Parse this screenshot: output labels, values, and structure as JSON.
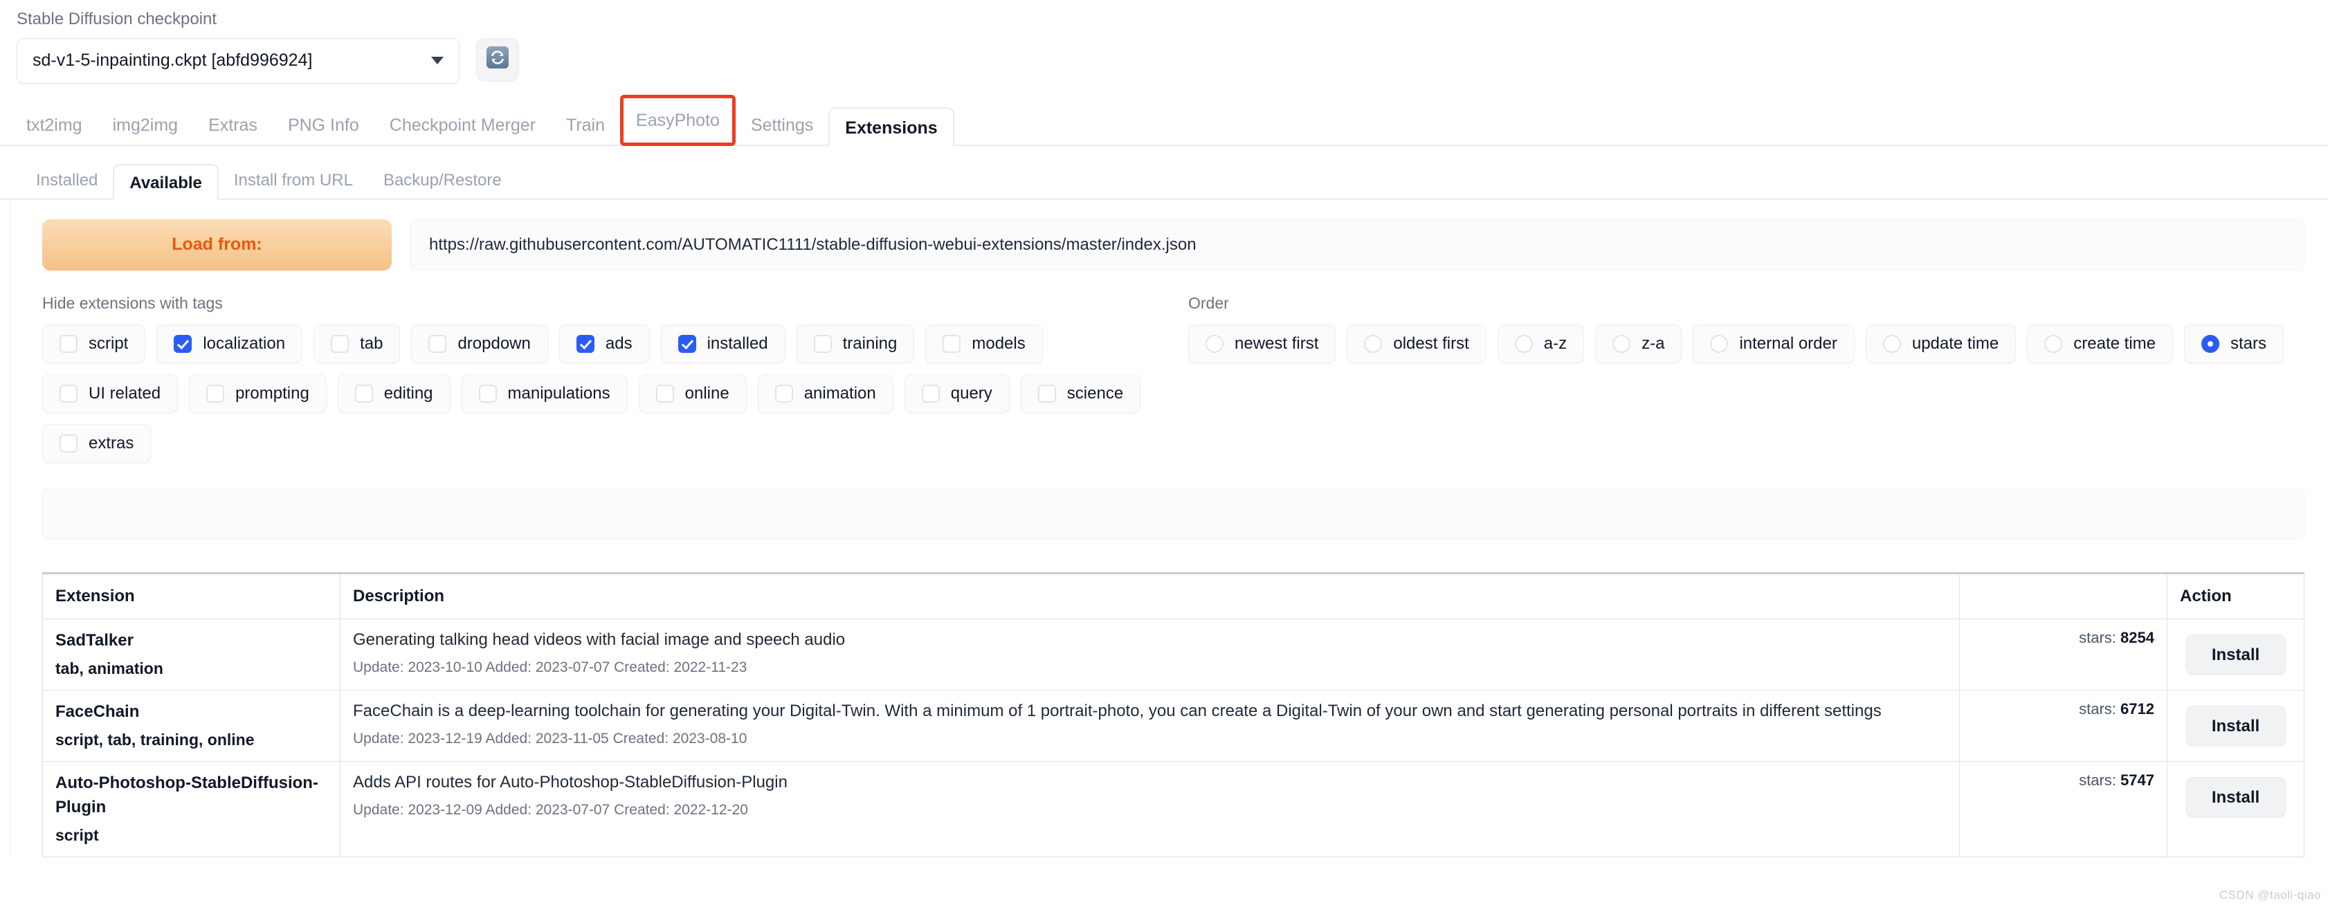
{
  "checkpoint": {
    "label": "Stable Diffusion checkpoint",
    "value": "sd-v1-5-inpainting.ckpt [abfd996924]",
    "refresh_icon": "refresh-icon"
  },
  "main_tabs": [
    {
      "label": "txt2img",
      "active": false,
      "highlight": false
    },
    {
      "label": "img2img",
      "active": false,
      "highlight": false
    },
    {
      "label": "Extras",
      "active": false,
      "highlight": false
    },
    {
      "label": "PNG Info",
      "active": false,
      "highlight": false
    },
    {
      "label": "Checkpoint Merger",
      "active": false,
      "highlight": false
    },
    {
      "label": "Train",
      "active": false,
      "highlight": false
    },
    {
      "label": "EasyPhoto",
      "active": false,
      "highlight": true
    },
    {
      "label": "Settings",
      "active": false,
      "highlight": false
    },
    {
      "label": "Extensions",
      "active": true,
      "highlight": false
    }
  ],
  "sub_tabs": [
    {
      "label": "Installed",
      "active": false
    },
    {
      "label": "Available",
      "active": true
    },
    {
      "label": "Install from URL",
      "active": false
    },
    {
      "label": "Backup/Restore",
      "active": false
    }
  ],
  "load": {
    "button_label": "Load from:",
    "url": "https://raw.githubusercontent.com/AUTOMATIC1111/stable-diffusion-webui-extensions/master/index.json"
  },
  "tags": {
    "label": "Hide extensions with tags",
    "items": [
      {
        "label": "script",
        "checked": false
      },
      {
        "label": "localization",
        "checked": true
      },
      {
        "label": "tab",
        "checked": false
      },
      {
        "label": "dropdown",
        "checked": false
      },
      {
        "label": "ads",
        "checked": true
      },
      {
        "label": "installed",
        "checked": true
      },
      {
        "label": "training",
        "checked": false
      },
      {
        "label": "models",
        "checked": false
      },
      {
        "label": "UI related",
        "checked": false
      },
      {
        "label": "prompting",
        "checked": false
      },
      {
        "label": "editing",
        "checked": false
      },
      {
        "label": "manipulations",
        "checked": false
      },
      {
        "label": "online",
        "checked": false
      },
      {
        "label": "animation",
        "checked": false
      },
      {
        "label": "query",
        "checked": false
      },
      {
        "label": "science",
        "checked": false
      },
      {
        "label": "extras",
        "checked": false
      }
    ]
  },
  "order": {
    "label": "Order",
    "items": [
      {
        "label": "newest first",
        "checked": false
      },
      {
        "label": "oldest first",
        "checked": false
      },
      {
        "label": "a-z",
        "checked": false
      },
      {
        "label": "z-a",
        "checked": false
      },
      {
        "label": "internal order",
        "checked": false
      },
      {
        "label": "update time",
        "checked": false
      },
      {
        "label": "create time",
        "checked": false
      },
      {
        "label": "stars",
        "checked": true
      }
    ]
  },
  "table": {
    "headers": {
      "extension": "Extension",
      "description": "Description",
      "stars": "",
      "action": "Action"
    },
    "rows": [
      {
        "name": "SadTalker",
        "tags": "tab, animation",
        "description": "Generating talking head videos with facial image and speech audio",
        "meta": "Update: 2023-10-10 Added: 2023-07-07 Created: 2022-11-23",
        "stars_label": "stars:",
        "stars_value": "8254",
        "action": "Install"
      },
      {
        "name": "FaceChain",
        "tags": "script, tab, training, online",
        "description": "FaceChain is a deep-learning toolchain for generating your Digital-Twin. With a minimum of 1 portrait-photo, you can create a Digital-Twin of your own and start generating personal portraits in different settings",
        "meta": "Update: 2023-12-19 Added: 2023-11-05 Created: 2023-08-10",
        "stars_label": "stars:",
        "stars_value": "6712",
        "action": "Install"
      },
      {
        "name": "Auto-Photoshop-StableDiffusion-Plugin",
        "tags": "script",
        "description": "Adds API routes for Auto-Photoshop-StableDiffusion-Plugin",
        "meta": "Update: 2023-12-09 Added: 2023-07-07 Created: 2022-12-20",
        "stars_label": "stars:",
        "stars_value": "5747",
        "action": "Install"
      }
    ]
  },
  "watermark": "CSDN @taoli-qiao",
  "colors": {
    "accent_blue": "#2a5cf5",
    "highlight_red": "#ef3c21",
    "load_orange": "#e8590c"
  }
}
